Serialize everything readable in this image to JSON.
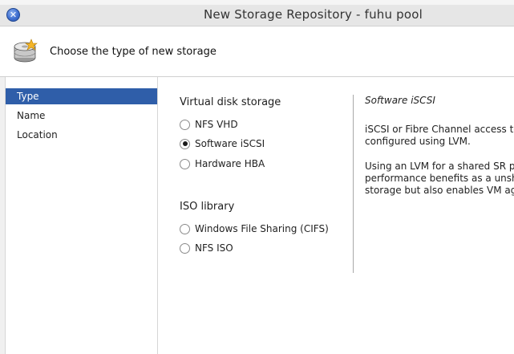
{
  "window": {
    "title": "New Storage Repository - fuhu pool",
    "close_glyph": "✕"
  },
  "header": {
    "title": "Choose the type of new storage",
    "icon": "disk-storage-icon"
  },
  "sidebar": {
    "items": [
      {
        "label": "Type",
        "active": true
      },
      {
        "label": "Name",
        "active": false
      },
      {
        "label": "Location",
        "active": false
      }
    ]
  },
  "options": {
    "virtual_disk": {
      "title": "Virtual disk storage",
      "items": [
        {
          "label": "NFS VHD",
          "checked": false
        },
        {
          "label": "Software iSCSI",
          "checked": true
        },
        {
          "label": "Hardware HBA",
          "checked": false
        }
      ]
    },
    "iso": {
      "title": "ISO library",
      "items": [
        {
          "label": "Windows File Sharing (CIFS)",
          "checked": false
        },
        {
          "label": "NFS ISO",
          "checked": false
        }
      ]
    }
  },
  "description": {
    "title": "Software iSCSI",
    "para1_line1": "iSCSI or Fibre Channel access to a",
    "para1_line2": "configured using LVM.",
    "para2_line1": "Using an LVM for a shared SR pro",
    "para2_line2": "performance benefits as a unshar",
    "para2_line3": "storage but also enables VM agil"
  },
  "colors": {
    "selection": "#2f5ea9",
    "close_button": "#3f6fd1"
  }
}
